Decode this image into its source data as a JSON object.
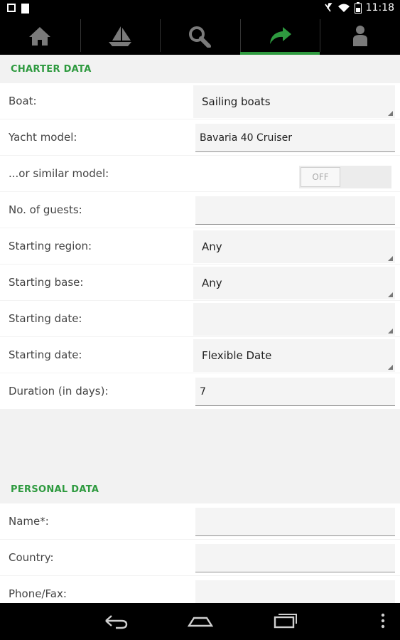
{
  "status_bar": {
    "time": "11:18"
  },
  "nav": {
    "tabs": [
      {
        "icon": "home-icon"
      },
      {
        "icon": "sailboat-icon"
      },
      {
        "icon": "search-icon"
      },
      {
        "icon": "share-arrow-icon"
      },
      {
        "icon": "person-icon"
      }
    ],
    "selected_index": 3,
    "accent": "#2e9a3f"
  },
  "charter": {
    "title": "CHARTER DATA",
    "boat": {
      "label": "Boat:",
      "value": "Sailing boats"
    },
    "yacht_model": {
      "label": "Yacht model:",
      "value": "Bavaria 40 Cruiser"
    },
    "similar": {
      "label": "...or similar model:",
      "toggle": "OFF"
    },
    "guests": {
      "label": "No. of guests:",
      "value": ""
    },
    "region": {
      "label": "Starting region:",
      "value": "Any"
    },
    "base": {
      "label": "Starting base:",
      "value": "Any"
    },
    "date1": {
      "label": "Starting date:",
      "value": ""
    },
    "date2": {
      "label": "Starting date:",
      "value": "Flexible Date"
    },
    "duration": {
      "label": "Duration (in days):",
      "value": "7"
    }
  },
  "personal": {
    "title": "PERSONAL DATA",
    "name": {
      "label": "Name*:",
      "value": ""
    },
    "country": {
      "label": "Country:",
      "value": ""
    },
    "phone": {
      "label": "Phone/Fax:",
      "value": ""
    }
  }
}
